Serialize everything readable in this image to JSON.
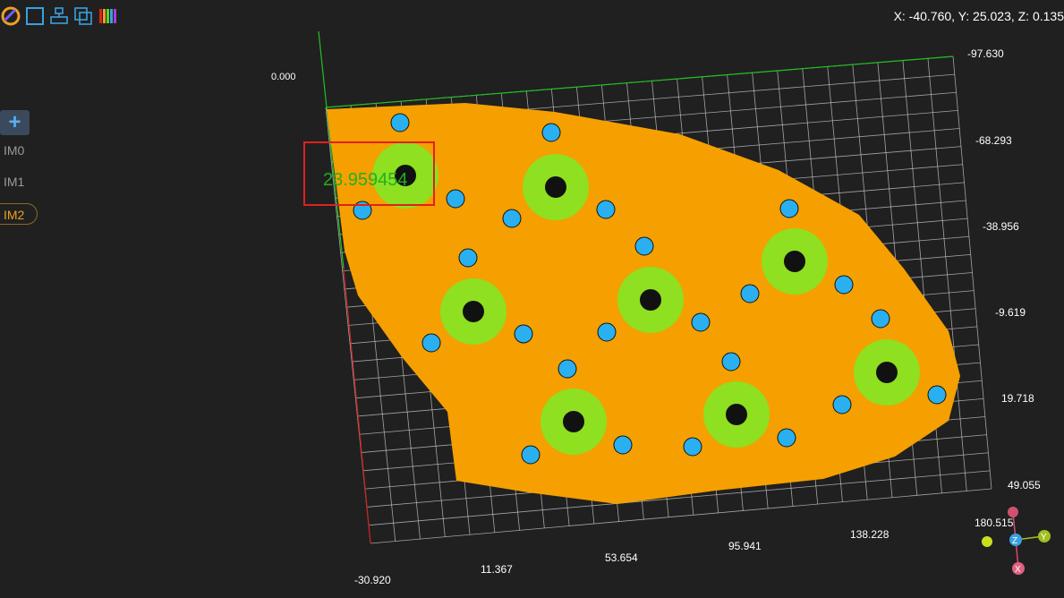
{
  "toolbar": {
    "icons": [
      "logo-icon",
      "square-select-icon",
      "align-icon",
      "copy-layers-icon",
      "color-bar-icon"
    ]
  },
  "coordinates": "X: -40.760, Y: 25.023, Z: 0.135",
  "sidebar": {
    "add_label": "+",
    "items": [
      {
        "label": "IM0",
        "active": false
      },
      {
        "label": "IM1",
        "active": false
      },
      {
        "label": "IM2",
        "active": true
      }
    ]
  },
  "viewer": {
    "y_ticks": [
      "-97.630",
      "-68.293",
      "-38.956",
      "-9.619",
      "19.718",
      "49.055"
    ],
    "x_ticks": [
      "-30.920",
      "11.367",
      "53.654",
      "95.941",
      "138.228",
      "180.515"
    ],
    "measurement": "23.959454",
    "overlay_text": "0.000"
  },
  "axes_gizmo": {
    "x": "X",
    "y": "Y",
    "z": "Z"
  },
  "colors": {
    "surface": "#f5a000",
    "ring": "#8ee020",
    "hole": "#2ab0f0",
    "accent_active": "#f0a020"
  }
}
